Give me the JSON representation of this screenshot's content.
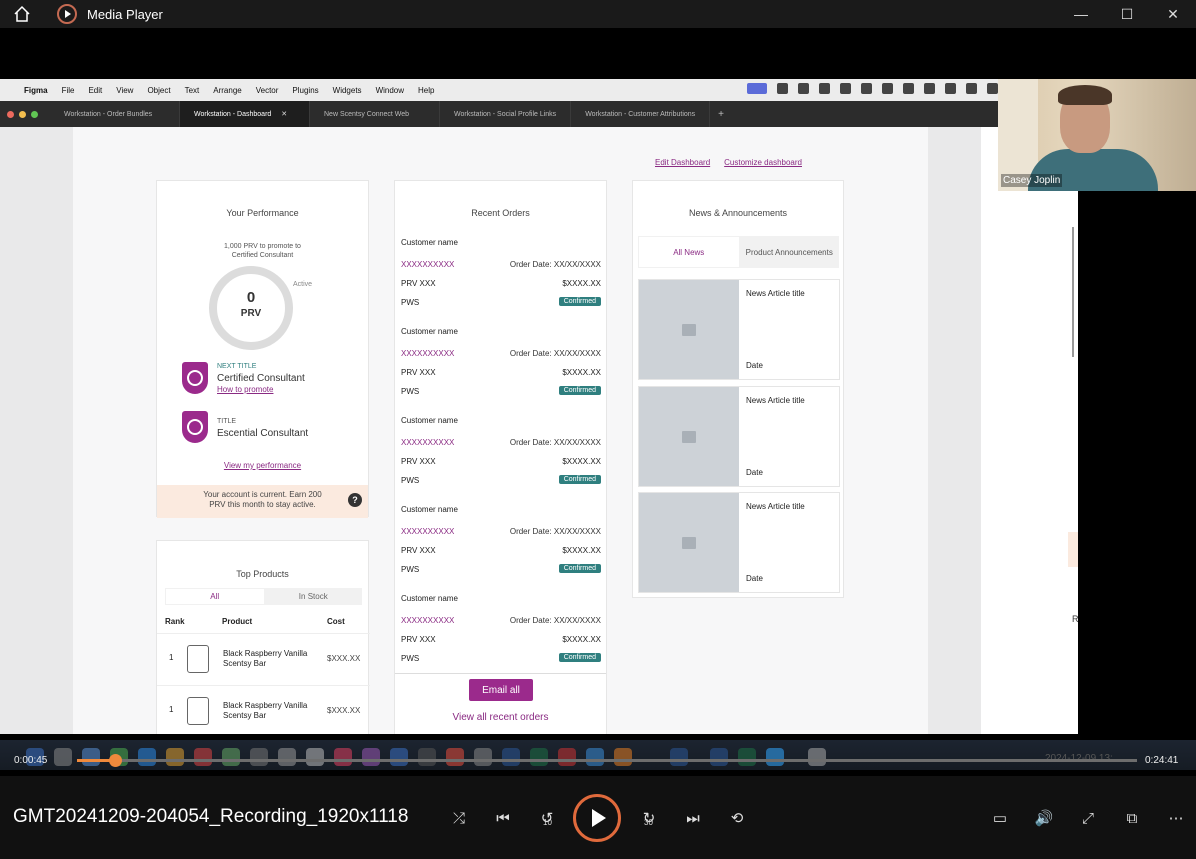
{
  "player": {
    "app_title": "Media Player",
    "file_title": "GMT20241209-204054_Recording_1920x1118",
    "elapsed": "0:00:45",
    "total": "0:24:41",
    "progress_percent": 3,
    "skip_back_seconds": "10",
    "skip_forward_seconds": "30",
    "overlay_timestamp": "2024-12-09 13:"
  },
  "mac_menu": {
    "app": "Figma",
    "items": [
      "File",
      "Edit",
      "View",
      "Object",
      "Text",
      "Arrange",
      "Vector",
      "Plugins",
      "Widgets",
      "Window",
      "Help"
    ]
  },
  "figma_tabs": [
    {
      "label": "Workstation - Order Bundles"
    },
    {
      "label": "Workstation - Dashboard"
    },
    {
      "label": "New Scentsy Connect Web"
    },
    {
      "label": "Workstation - Social Profile Links"
    },
    {
      "label": "Workstation - Customer Attributions"
    }
  ],
  "dashboard": {
    "edit_dashboard": "Edit Dashboard",
    "customize_dashboard": "Customize dashboard",
    "performance": {
      "title": "Your Performance",
      "promo_line1": "1,000 PRV to promote to",
      "promo_line2": "Certified Consultant",
      "gauge_value": "0",
      "gauge_unit": "PRV",
      "active_label": "Active",
      "next_title_label": "NEXT TITLE",
      "next_title": "Certified Consultant",
      "how_to_promote": "How to promote",
      "title_label": "TITLE",
      "title_value": "Escential Consultant",
      "view_performance": "View my performance",
      "account_line1": "Your account is current. Earn 200",
      "account_line2": "PRV this month to stay active.",
      "help": "?"
    },
    "top_products": {
      "title": "Top Products",
      "tab_all": "All",
      "tab_in_stock": "In Stock",
      "col_rank": "Rank",
      "col_product": "Product",
      "col_cost": "Cost",
      "rows": [
        {
          "rank": "1",
          "name": "Black Raspberry Vanilla Scentsy Bar",
          "cost": "$XXX.XX"
        },
        {
          "rank": "1",
          "name": "Black Raspberry Vanilla Scentsy Bar",
          "cost": "$XXX.XX"
        }
      ]
    },
    "recent_orders": {
      "title": "Recent Orders",
      "orders": [
        {
          "customer": "Customer name",
          "id": "XXXXXXXXXX",
          "date": "Order Date: XX/XX/XXXX",
          "prv": "PRV XXX",
          "amount": "$XXXX.XX",
          "pws": "PWS",
          "status": "Confirmed"
        },
        {
          "customer": "Customer name",
          "id": "XXXXXXXXXX",
          "date": "Order Date: XX/XX/XXXX",
          "prv": "PRV XXX",
          "amount": "$XXXX.XX",
          "pws": "PWS",
          "status": "Confirmed"
        },
        {
          "customer": "Customer name",
          "id": "XXXXXXXXXX",
          "date": "Order Date: XX/XX/XXXX",
          "prv": "PRV XXX",
          "amount": "$XXXX.XX",
          "pws": "PWS",
          "status": "Confirmed"
        },
        {
          "customer": "Customer name",
          "id": "XXXXXXXXXX",
          "date": "Order Date: XX/XX/XXXX",
          "prv": "PRV XXX",
          "amount": "$XXXX.XX",
          "pws": "PWS",
          "status": "Confirmed"
        },
        {
          "customer": "Customer name",
          "id": "XXXXXXXXXX",
          "date": "Order Date: XX/XX/XXXX",
          "prv": "PRV XXX",
          "amount": "$XXXX.XX",
          "pws": "PWS",
          "status": "Confirmed"
        }
      ],
      "email_all": "Email all",
      "view_all": "View all recent orders"
    },
    "news": {
      "title": "News & Announcements",
      "tab_all": "All News",
      "tab_product": "Product Announcements",
      "articles": [
        {
          "title": "News Article title",
          "date": "Date"
        },
        {
          "title": "News Article title",
          "date": "Date"
        },
        {
          "title": "News Article title",
          "date": "Date"
        }
      ]
    },
    "right_peek": "R"
  },
  "webcam": {
    "participant": "Casey Joplin"
  },
  "colors": {
    "brand": "#9b2a8c",
    "confirmed": "#2f7f7f",
    "accent": "#f08a3c"
  }
}
